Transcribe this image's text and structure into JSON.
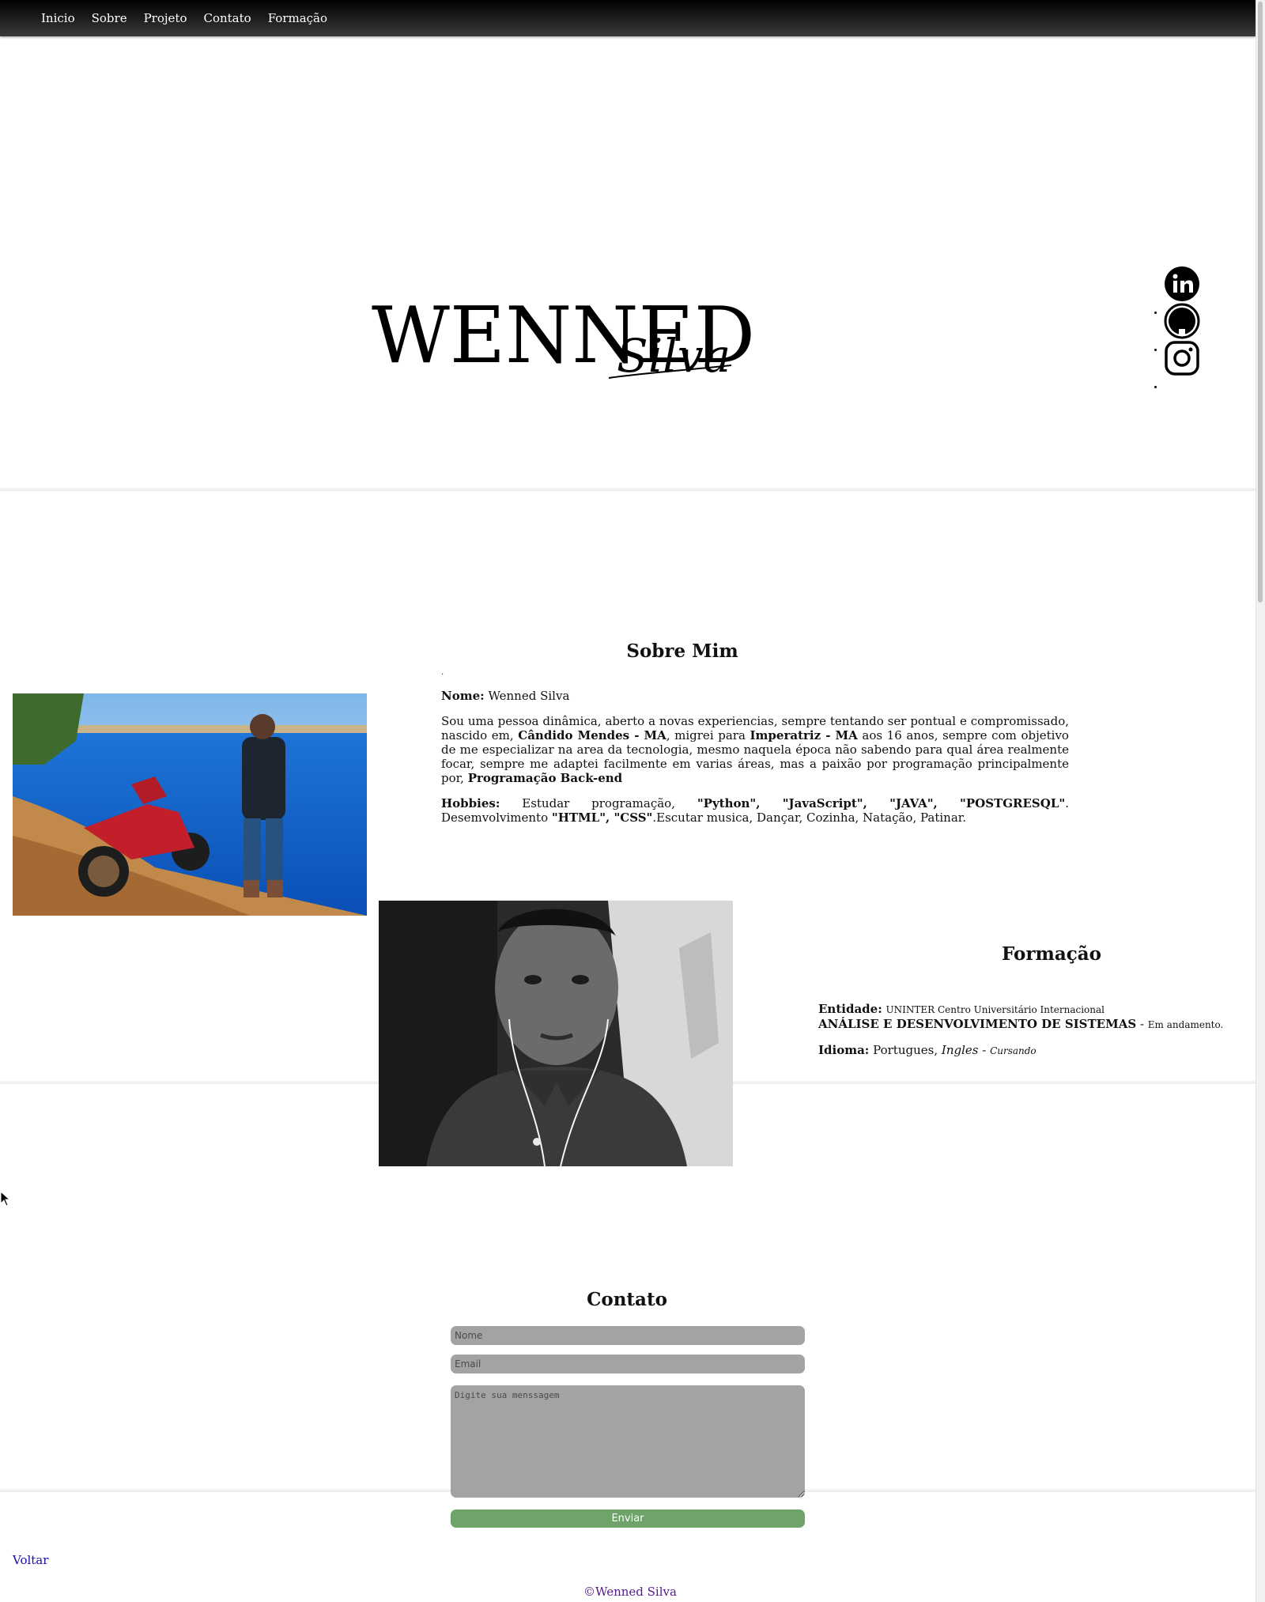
{
  "nav": {
    "items": [
      {
        "label": "Inicio"
      },
      {
        "label": "Sobre"
      },
      {
        "label": "Projeto"
      },
      {
        "label": "Contato"
      },
      {
        "label": "Formação"
      }
    ]
  },
  "hero": {
    "logo_main": "WENNED",
    "logo_script": "Silva",
    "social": [
      {
        "icon": "linkedin-icon"
      },
      {
        "icon": "github-icon"
      },
      {
        "icon": "instagram-icon"
      }
    ]
  },
  "about": {
    "title": "Sobre Mim",
    "dot": ".",
    "name_label": "Nome:",
    "name_value": "Wenned Silva",
    "bio_1": "Sou uma pessoa dinâmica, aberto a novas experiencias, sempre tentando ser pontual e compromissado, nascido em,",
    "bio_city_1": "Cândido Mendes - MA",
    "bio_2": ", migrei para",
    "bio_city_2": "Imperatriz - MA",
    "bio_3": "aos 16 anos, sempre com objetivo de me especializar na area da tecnologia, mesmo naquela época não sabendo para qual área realmente focar, sempre me adaptei facilmente em varias áreas, mas a paixão por programação principalmente por,",
    "bio_focus": "Programação Back-end",
    "hobbies_label": "Hobbies:",
    "hobbies_1": "Estudar programação,",
    "hobbies_langs": "\"Python\", \"JavaScript\", \"JAVA\", \"POSTGRESQL\"",
    "hobbies_2": ". Desemvolvimento",
    "hobbies_web": "\"HTML\", \"CSS\"",
    "hobbies_3": ".Escutar musica, Dançar, Cozinha, Natação, Patinar."
  },
  "formacao": {
    "title": "Formação",
    "entity_label": "Entidade:",
    "entity_value": "UNINTER Centro Universitário Internacional",
    "course": "ANÁLISE E DESENVOLVIMENTO DE SISTEMAS",
    "course_sep": " - ",
    "course_status": "Em andamento.",
    "language_label": "Idioma:",
    "language_1": "Portugues,",
    "language_2": "Ingles",
    "language_sep": " - ",
    "language_status": "Cursando"
  },
  "contact": {
    "title": "Contato",
    "name_placeholder": "Nome",
    "email_placeholder": "Email",
    "message_placeholder": "Digite sua menssagem",
    "send_label": "Enviar"
  },
  "footer": {
    "back_label": "Voltar",
    "copyright": "©Wenned Silva"
  },
  "colors": {
    "nav_bg": "#000000",
    "field_bg": "#a3a3a3",
    "send_bg": "#6ea36a",
    "link": "#1a0dab",
    "visited": "#551a8b"
  }
}
